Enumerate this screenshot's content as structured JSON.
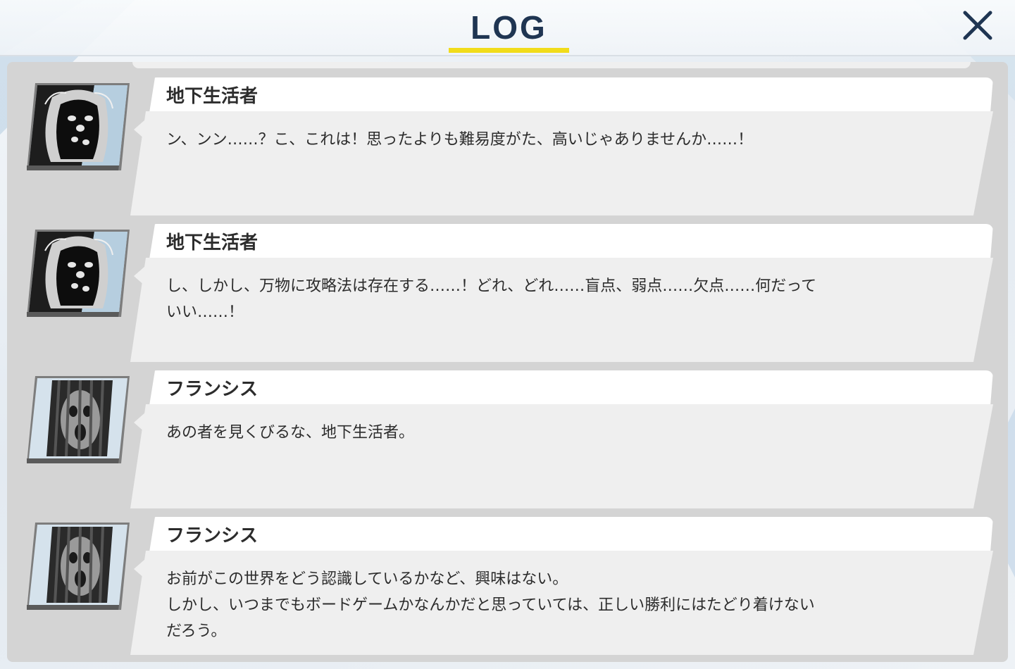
{
  "header": {
    "title": "LOG",
    "close_label": "×",
    "accent_color": "#f1dc1b",
    "title_color": "#1f3552"
  },
  "log": {
    "entries": [
      {
        "speaker": "地下生活者",
        "portrait_icon": "masked-figure-portrait",
        "text": "ン、ンン……？こ、これは！思ったよりも難易度がた、高いじゃありませんか……！"
      },
      {
        "speaker": "地下生活者",
        "portrait_icon": "masked-figure-portrait",
        "text": "し、しかし、万物に攻略法は存在する……！どれ、どれ……盲点、弱点……欠点……何だって\nいい……！"
      },
      {
        "speaker": "フランシス",
        "portrait_icon": "caged-face-portrait",
        "text": "あの者を見くびるな、地下生活者。"
      },
      {
        "speaker": "フランシス",
        "portrait_icon": "caged-face-portrait",
        "text": "お前がこの世界をどう認識しているかなど、興味はない。\nしかし、いつまでもボードゲームかなんかだと思っていては、正しい勝利にはたどり着けない\nだろう。"
      }
    ]
  }
}
